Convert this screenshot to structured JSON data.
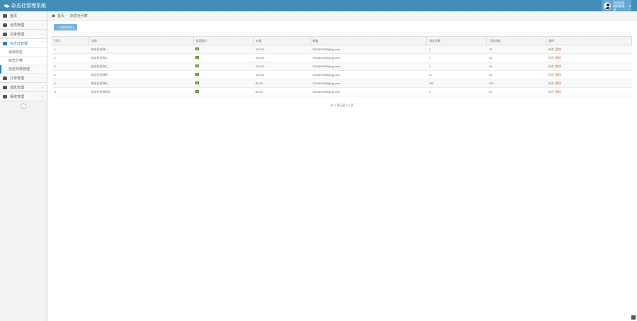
{
  "header": {
    "app_title": "杂志社管理系统",
    "user_line1": "欢迎光临,",
    "user_line2": "超级管理员"
  },
  "sidebar": {
    "items": [
      {
        "label": "首页",
        "icon": "dashboard-icon",
        "expandable": false
      },
      {
        "label": "会员管理",
        "icon": "users-icon",
        "expandable": true
      },
      {
        "label": "文章管理",
        "icon": "file-icon",
        "expandable": true
      },
      {
        "label": "杂志社管理",
        "icon": "settings-icon",
        "expandable": true,
        "active": true
      },
      {
        "label": "订单管理",
        "icon": "cart-icon",
        "expandable": true
      },
      {
        "label": "消息管理",
        "icon": "message-icon",
        "expandable": true
      },
      {
        "label": "系统管理",
        "icon": "gear-icon",
        "expandable": true
      }
    ],
    "subitems": [
      "添加杂志",
      "杂志分类",
      "杂志列表管理"
    ],
    "collapse_label": "«"
  },
  "breadcrumb": {
    "home": "首页",
    "current": "杂志社列表"
  },
  "toolbar": {
    "add_label": "+ 添加杂志社"
  },
  "table": {
    "headers": [
      "序号",
      "名称",
      "封面图片",
      "价格",
      "邮箱",
      "浏览次数",
      "订阅次数",
      "操作"
    ],
    "rows": [
      [
        "1",
        "杂志社名称一",
        "",
        "100.00",
        "1234567890@qq.com",
        "1",
        "10",
        ""
      ],
      [
        "2",
        "杂志社名称二",
        "",
        "100.00",
        "1234567890@qq.com",
        "1",
        "10",
        ""
      ],
      [
        "3",
        "杂志社名称三",
        "",
        "100.00",
        "1234567890@qq.com",
        "1",
        "10",
        ""
      ],
      [
        "4",
        "杂志社名称四",
        "",
        "100.00",
        "1234567890@qq.com",
        "11",
        "10",
        ""
      ],
      [
        "5",
        "杂志社名称五",
        "",
        "50.00",
        "1234567890@qq.com",
        "245",
        "105",
        ""
      ],
      [
        "6",
        "杂志社名称测试",
        "",
        "50.00",
        "1234567890@qq.com",
        "0",
        "10",
        ""
      ]
    ],
    "edit_label": "修改",
    "delete_label": "删除"
  },
  "pager": {
    "text": "共 6 条记录 1/1 页"
  },
  "colors": {
    "header": "#438eb9",
    "accent": "#2b7dbc",
    "edit": "#69aa46",
    "delete": "#d15b47"
  }
}
